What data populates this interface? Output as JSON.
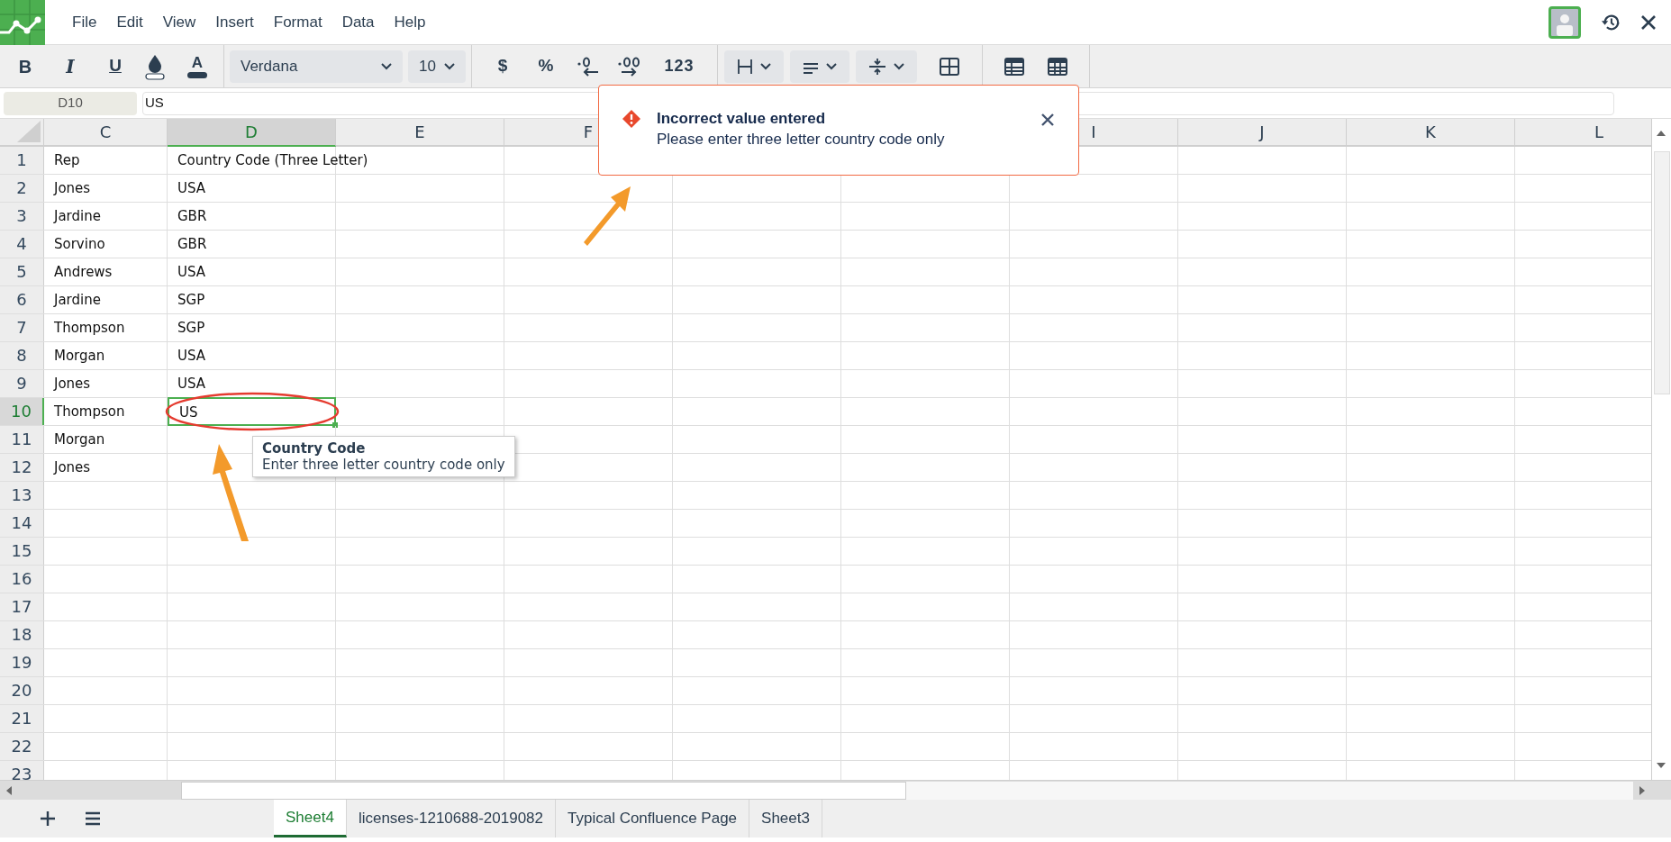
{
  "menu": [
    "File",
    "Edit",
    "View",
    "Insert",
    "Format",
    "Data",
    "Help"
  ],
  "toolbar": {
    "bold": "B",
    "italic": "I",
    "underline": "U",
    "text_color": "A",
    "font": "Verdana",
    "font_size": "10",
    "currency": "$",
    "percent": "%",
    "number_format": "123"
  },
  "formula_bar": {
    "cell_ref": "D10",
    "value": "US"
  },
  "toast": {
    "title": "Incorrect value entered",
    "message": "Please enter three letter country code only"
  },
  "columns": [
    {
      "label": "C",
      "selected": false
    },
    {
      "label": "D",
      "selected": true
    },
    {
      "label": "E",
      "selected": false
    },
    {
      "label": "F",
      "selected": false
    },
    {},
    {},
    {
      "label": "I",
      "selected": false
    },
    {
      "label": "J",
      "selected": false
    },
    {
      "label": "K",
      "selected": false
    },
    {
      "label": "L",
      "selected": false
    }
  ],
  "rows": [
    {
      "number": "1",
      "selected": false,
      "cells": [
        "Rep",
        "Country Code (Three Letter)"
      ]
    },
    {
      "number": "2",
      "selected": false,
      "cells": [
        "Jones",
        "USA"
      ]
    },
    {
      "number": "3",
      "selected": false,
      "cells": [
        "Jardine",
        "GBR"
      ]
    },
    {
      "number": "4",
      "selected": false,
      "cells": [
        "Sorvino",
        "GBR"
      ]
    },
    {
      "number": "5",
      "selected": false,
      "cells": [
        "Andrews",
        "USA"
      ]
    },
    {
      "number": "6",
      "selected": false,
      "cells": [
        "Jardine",
        "SGP"
      ]
    },
    {
      "number": "7",
      "selected": false,
      "cells": [
        "Thompson",
        "SGP"
      ]
    },
    {
      "number": "8",
      "selected": false,
      "cells": [
        "Morgan",
        "USA"
      ]
    },
    {
      "number": "9",
      "selected": false,
      "cells": [
        "Jones",
        "USA"
      ]
    },
    {
      "number": "10",
      "selected": true,
      "cells": [
        "Thompson",
        "US"
      ]
    },
    {
      "number": "11",
      "selected": false,
      "cells": [
        "Morgan"
      ]
    },
    {
      "number": "12",
      "selected": false,
      "cells": [
        "Jones"
      ]
    },
    {
      "number": "13",
      "selected": false,
      "cells": []
    },
    {
      "number": "14",
      "selected": false,
      "cells": []
    },
    {
      "number": "15",
      "selected": false,
      "cells": []
    },
    {
      "number": "16",
      "selected": false,
      "cells": []
    },
    {
      "number": "17",
      "selected": false,
      "cells": []
    },
    {
      "number": "18",
      "selected": false,
      "cells": []
    },
    {
      "number": "19",
      "selected": false,
      "cells": []
    },
    {
      "number": "20",
      "selected": false,
      "cells": []
    },
    {
      "number": "21",
      "selected": false,
      "cells": []
    },
    {
      "number": "22",
      "selected": false,
      "cells": []
    },
    {
      "number": "23",
      "selected": false,
      "cells": []
    }
  ],
  "tooltip": {
    "title": "Country Code",
    "message": "Enter three letter country code only"
  },
  "sheet_tabs": [
    {
      "label": "Sheet4",
      "selected": true
    },
    {
      "label": "licenses-1210688-2019082",
      "selected": false
    },
    {
      "label": "Typical Confluence Page",
      "selected": false
    },
    {
      "label": "Sheet3",
      "selected": false
    }
  ]
}
